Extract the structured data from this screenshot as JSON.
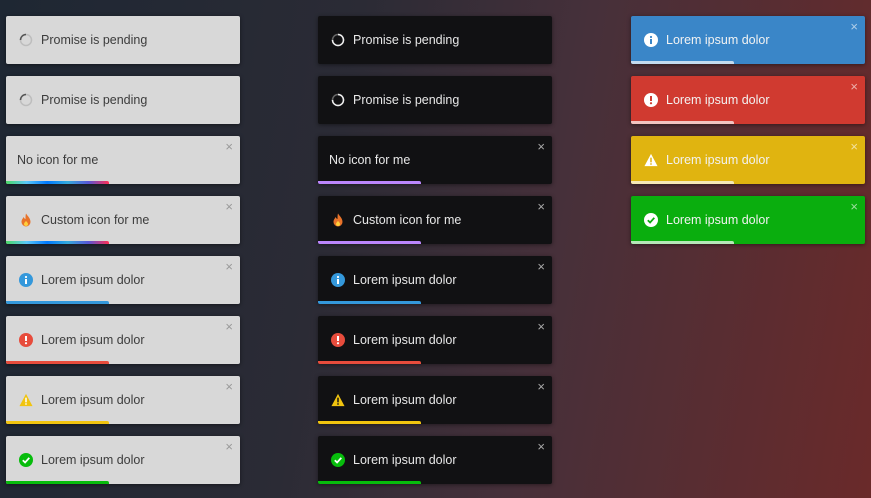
{
  "colors": {
    "info": "#3498db",
    "error": "#e74c3c",
    "warning": "#f1c40f",
    "success": "#07bc0c",
    "default": "#bb86fc",
    "info_bg": "#3a86c8",
    "error_bg": "#d03a30",
    "warning_bg": "#e0b410",
    "success_bg": "#0aae0e"
  },
  "close_symbol": "×",
  "light_column": [
    {
      "text": "Promise is pending",
      "icon": "spinner-icon"
    },
    {
      "text": "Promise is pending",
      "icon": "spinner-icon"
    },
    {
      "text": "No icon for me",
      "icon": "none"
    },
    {
      "text": "Custom icon for me",
      "icon": "fire-icon"
    },
    {
      "text": "Lorem ipsum dolor",
      "icon": "info-icon"
    },
    {
      "text": "Lorem ipsum dolor",
      "icon": "error-icon"
    },
    {
      "text": "Lorem ipsum dolor",
      "icon": "warning-icon"
    },
    {
      "text": "Lorem ipsum dolor",
      "icon": "success-icon"
    }
  ],
  "dark_column": [
    {
      "text": "Promise is pending",
      "icon": "spinner-icon"
    },
    {
      "text": "Promise is pending",
      "icon": "spinner-icon"
    },
    {
      "text": "No icon for me",
      "icon": "none"
    },
    {
      "text": "Custom icon for me",
      "icon": "fire-icon"
    },
    {
      "text": "Lorem ipsum dolor",
      "icon": "info-icon"
    },
    {
      "text": "Lorem ipsum dolor",
      "icon": "error-icon"
    },
    {
      "text": "Lorem ipsum dolor",
      "icon": "warning-icon"
    },
    {
      "text": "Lorem ipsum dolor",
      "icon": "success-icon"
    }
  ],
  "colored_column": [
    {
      "text": "Lorem ipsum dolor",
      "icon": "info-icon"
    },
    {
      "text": "Lorem ipsum dolor",
      "icon": "error-icon"
    },
    {
      "text": "Lorem ipsum dolor",
      "icon": "warning-icon"
    },
    {
      "text": "Lorem ipsum dolor",
      "icon": "success-icon"
    }
  ],
  "progress": 0.44
}
